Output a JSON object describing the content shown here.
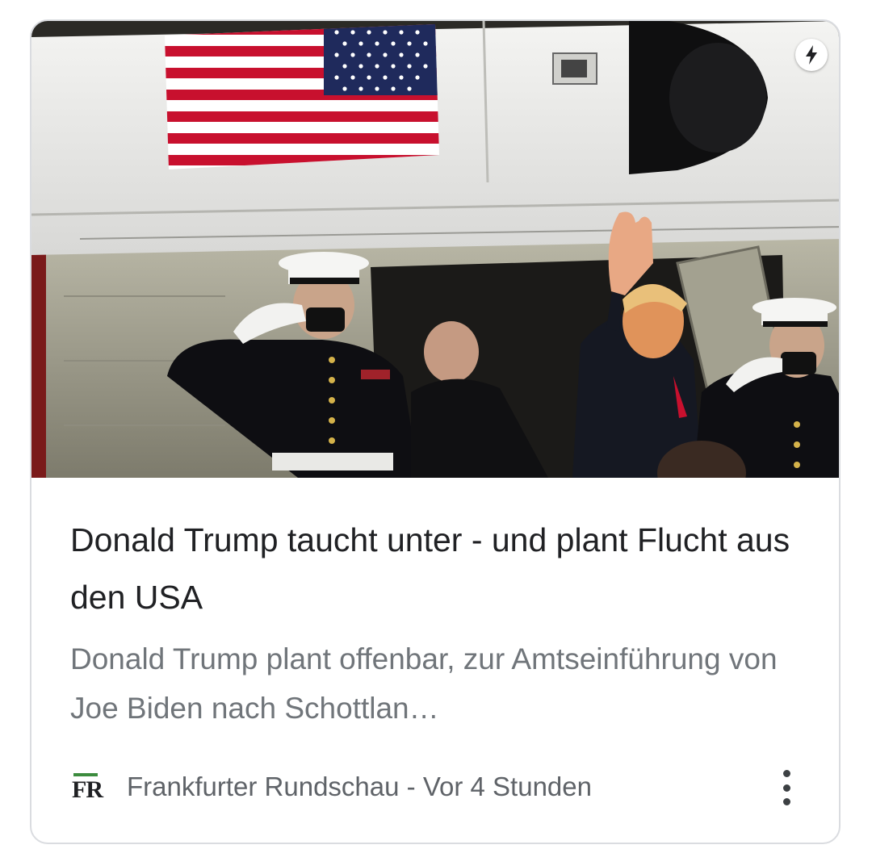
{
  "article": {
    "image_alt": "US flag on helicopter; marines saluting, man waving",
    "headline": "Donald Trump taucht unter - und plant Flucht aus den USA",
    "snippet": "Donald Trump plant offenbar, zur Amtseinführung von Joe Biden nach Schottlan…",
    "source_logo_text": "FR",
    "source": "Frankfurter Rundschau",
    "separator": " - ",
    "time": "Vor 4 Stunden",
    "amp_icon": "lightning-bolt-icon",
    "menu_icon": "more-vert-icon"
  },
  "colors": {
    "headline": "#202124",
    "snippet": "#70757a",
    "meta": "#5f6368",
    "logo_accent": "#3c8c3e",
    "card_border": "#dadce0"
  }
}
